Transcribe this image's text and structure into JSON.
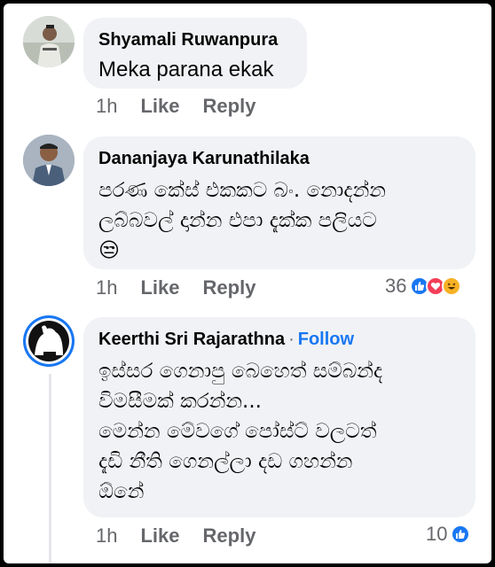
{
  "comments": [
    {
      "author": "Shyamali Ruwanpura",
      "text": "Meka parana ekak",
      "time": "1h",
      "like": "Like",
      "reply": "Reply"
    },
    {
      "author": "Dananjaya Karunathilaka",
      "text_lines": [
        "පරණ කේස් එකකට බං. නොදන්න",
        "ලබ්බවල් දාන්න එපා දැක්ක පලියට",
        "😒"
      ],
      "time": "1h",
      "like": "Like",
      "reply": "Reply",
      "reaction_count": "36",
      "reaction_icons": [
        "like-icon",
        "love-icon",
        "haha-icon"
      ]
    },
    {
      "author": "Keerthi Sri Rajarathna",
      "separator": "·",
      "follow": "Follow",
      "text_lines": [
        "ඉස්සර ගෙනාපු බෙහෙත් සම්බන්ද",
        "විමසීමක් කරන්න...",
        "මෙන්න මේවගේ පෝස්ට් වලටත්",
        "දැඩි නීති ගෙනල්ලා දඩ ගහන්න",
        "ඕනේ"
      ],
      "time": "1h",
      "like": "Like",
      "reply": "Reply",
      "reaction_count": "10",
      "reaction_icons": [
        "like-icon"
      ]
    }
  ],
  "colors": {
    "bubble": "#f0f2f5",
    "text": "#050505",
    "secondary": "#65676b",
    "accent": "#1877f2"
  }
}
